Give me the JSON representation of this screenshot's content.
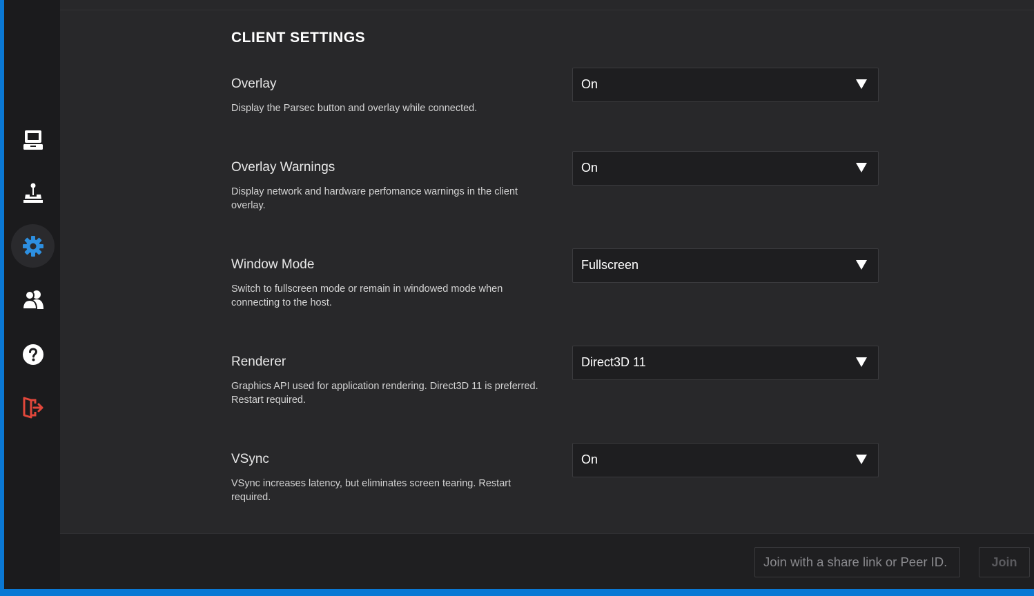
{
  "settings_page": {
    "section_title": "CLIENT SETTINGS",
    "settings": [
      {
        "label": "Overlay",
        "description": "Display the Parsec button and overlay while connected.",
        "value": "On"
      },
      {
        "label": "Overlay Warnings",
        "description": "Display network and hardware perfomance warnings in the client overlay.",
        "value": "On"
      },
      {
        "label": "Window Mode",
        "description": "Switch to fullscreen mode or remain in windowed mode when connecting to the host.",
        "value": "Fullscreen"
      },
      {
        "label": "Renderer",
        "description": "Graphics API used for application rendering. Direct3D 11 is preferred. Restart required.",
        "value": "Direct3D 11"
      },
      {
        "label": "VSync",
        "description": "VSync increases latency, but eliminates screen tearing. Restart required.",
        "value": "On"
      }
    ]
  },
  "sidebar": {
    "items": [
      {
        "icon": "computer-icon",
        "active": false
      },
      {
        "icon": "arcade-joystick-icon",
        "active": false
      },
      {
        "icon": "gear-icon",
        "active": true
      },
      {
        "icon": "friends-icon",
        "active": false
      },
      {
        "icon": "help-icon",
        "active": false
      },
      {
        "icon": "logout-icon",
        "active": false
      }
    ]
  },
  "footer": {
    "join_placeholder": "Join with a share link or Peer ID.",
    "join_label": "Join"
  },
  "colors": {
    "accent": "#2d8fe0",
    "logout": "#e2473b",
    "desktop": "#0a78d4"
  }
}
